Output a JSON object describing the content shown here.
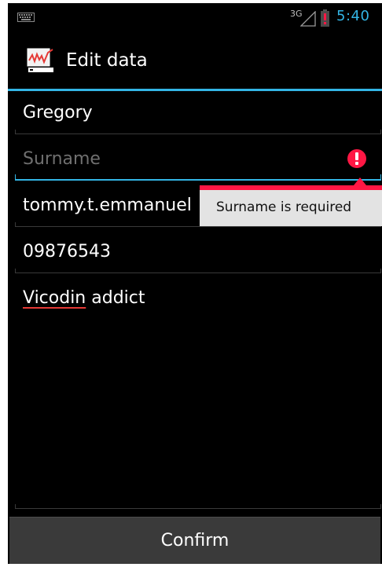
{
  "status_bar": {
    "network_type": "3G",
    "time": "5:40",
    "icons": [
      "keyboard-icon",
      "signal-icon",
      "battery-alert-icon"
    ]
  },
  "action_bar": {
    "title": "Edit data",
    "icon": "chart-app-icon"
  },
  "form": {
    "first_name": {
      "value": "Gregory"
    },
    "surname": {
      "value": "",
      "placeholder": "Surname"
    },
    "email": {
      "value": "tommy.t.emmanuel"
    },
    "phone": {
      "value": "09876543"
    },
    "notes": {
      "misspelled_word": "Vicodin",
      "rest": " addict"
    }
  },
  "error": {
    "message": "Surname is required",
    "icon": "error-exclamation-icon",
    "color": "#ff1744"
  },
  "confirm_button": {
    "label": "Confirm"
  },
  "colors": {
    "accent": "#33b5e5",
    "error": "#ff1744",
    "background": "#000000"
  }
}
